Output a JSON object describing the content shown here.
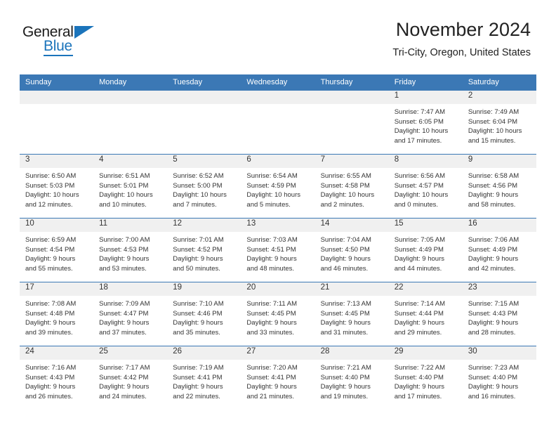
{
  "brand": {
    "name_part1": "General",
    "name_part2": "Blue",
    "accent_color": "#1b74bb"
  },
  "header": {
    "title": "November 2024",
    "subtitle": "Tri-City, Oregon, United States"
  },
  "calendar": {
    "header_color": "#3b78b5",
    "daynum_band_color": "#f0f0f0",
    "weekday_headers": [
      "Sunday",
      "Monday",
      "Tuesday",
      "Wednesday",
      "Thursday",
      "Friday",
      "Saturday"
    ],
    "weeks": [
      [
        {
          "day": "",
          "lines": []
        },
        {
          "day": "",
          "lines": []
        },
        {
          "day": "",
          "lines": []
        },
        {
          "day": "",
          "lines": []
        },
        {
          "day": "",
          "lines": []
        },
        {
          "day": "1",
          "lines": [
            "Sunrise: 7:47 AM",
            "Sunset: 6:05 PM",
            "Daylight: 10 hours",
            "and 17 minutes."
          ]
        },
        {
          "day": "2",
          "lines": [
            "Sunrise: 7:49 AM",
            "Sunset: 6:04 PM",
            "Daylight: 10 hours",
            "and 15 minutes."
          ]
        }
      ],
      [
        {
          "day": "3",
          "lines": [
            "Sunrise: 6:50 AM",
            "Sunset: 5:03 PM",
            "Daylight: 10 hours",
            "and 12 minutes."
          ]
        },
        {
          "day": "4",
          "lines": [
            "Sunrise: 6:51 AM",
            "Sunset: 5:01 PM",
            "Daylight: 10 hours",
            "and 10 minutes."
          ]
        },
        {
          "day": "5",
          "lines": [
            "Sunrise: 6:52 AM",
            "Sunset: 5:00 PM",
            "Daylight: 10 hours",
            "and 7 minutes."
          ]
        },
        {
          "day": "6",
          "lines": [
            "Sunrise: 6:54 AM",
            "Sunset: 4:59 PM",
            "Daylight: 10 hours",
            "and 5 minutes."
          ]
        },
        {
          "day": "7",
          "lines": [
            "Sunrise: 6:55 AM",
            "Sunset: 4:58 PM",
            "Daylight: 10 hours",
            "and 2 minutes."
          ]
        },
        {
          "day": "8",
          "lines": [
            "Sunrise: 6:56 AM",
            "Sunset: 4:57 PM",
            "Daylight: 10 hours",
            "and 0 minutes."
          ]
        },
        {
          "day": "9",
          "lines": [
            "Sunrise: 6:58 AM",
            "Sunset: 4:56 PM",
            "Daylight: 9 hours",
            "and 58 minutes."
          ]
        }
      ],
      [
        {
          "day": "10",
          "lines": [
            "Sunrise: 6:59 AM",
            "Sunset: 4:54 PM",
            "Daylight: 9 hours",
            "and 55 minutes."
          ]
        },
        {
          "day": "11",
          "lines": [
            "Sunrise: 7:00 AM",
            "Sunset: 4:53 PM",
            "Daylight: 9 hours",
            "and 53 minutes."
          ]
        },
        {
          "day": "12",
          "lines": [
            "Sunrise: 7:01 AM",
            "Sunset: 4:52 PM",
            "Daylight: 9 hours",
            "and 50 minutes."
          ]
        },
        {
          "day": "13",
          "lines": [
            "Sunrise: 7:03 AM",
            "Sunset: 4:51 PM",
            "Daylight: 9 hours",
            "and 48 minutes."
          ]
        },
        {
          "day": "14",
          "lines": [
            "Sunrise: 7:04 AM",
            "Sunset: 4:50 PM",
            "Daylight: 9 hours",
            "and 46 minutes."
          ]
        },
        {
          "day": "15",
          "lines": [
            "Sunrise: 7:05 AM",
            "Sunset: 4:49 PM",
            "Daylight: 9 hours",
            "and 44 minutes."
          ]
        },
        {
          "day": "16",
          "lines": [
            "Sunrise: 7:06 AM",
            "Sunset: 4:49 PM",
            "Daylight: 9 hours",
            "and 42 minutes."
          ]
        }
      ],
      [
        {
          "day": "17",
          "lines": [
            "Sunrise: 7:08 AM",
            "Sunset: 4:48 PM",
            "Daylight: 9 hours",
            "and 39 minutes."
          ]
        },
        {
          "day": "18",
          "lines": [
            "Sunrise: 7:09 AM",
            "Sunset: 4:47 PM",
            "Daylight: 9 hours",
            "and 37 minutes."
          ]
        },
        {
          "day": "19",
          "lines": [
            "Sunrise: 7:10 AM",
            "Sunset: 4:46 PM",
            "Daylight: 9 hours",
            "and 35 minutes."
          ]
        },
        {
          "day": "20",
          "lines": [
            "Sunrise: 7:11 AM",
            "Sunset: 4:45 PM",
            "Daylight: 9 hours",
            "and 33 minutes."
          ]
        },
        {
          "day": "21",
          "lines": [
            "Sunrise: 7:13 AM",
            "Sunset: 4:45 PM",
            "Daylight: 9 hours",
            "and 31 minutes."
          ]
        },
        {
          "day": "22",
          "lines": [
            "Sunrise: 7:14 AM",
            "Sunset: 4:44 PM",
            "Daylight: 9 hours",
            "and 29 minutes."
          ]
        },
        {
          "day": "23",
          "lines": [
            "Sunrise: 7:15 AM",
            "Sunset: 4:43 PM",
            "Daylight: 9 hours",
            "and 28 minutes."
          ]
        }
      ],
      [
        {
          "day": "24",
          "lines": [
            "Sunrise: 7:16 AM",
            "Sunset: 4:43 PM",
            "Daylight: 9 hours",
            "and 26 minutes."
          ]
        },
        {
          "day": "25",
          "lines": [
            "Sunrise: 7:17 AM",
            "Sunset: 4:42 PM",
            "Daylight: 9 hours",
            "and 24 minutes."
          ]
        },
        {
          "day": "26",
          "lines": [
            "Sunrise: 7:19 AM",
            "Sunset: 4:41 PM",
            "Daylight: 9 hours",
            "and 22 minutes."
          ]
        },
        {
          "day": "27",
          "lines": [
            "Sunrise: 7:20 AM",
            "Sunset: 4:41 PM",
            "Daylight: 9 hours",
            "and 21 minutes."
          ]
        },
        {
          "day": "28",
          "lines": [
            "Sunrise: 7:21 AM",
            "Sunset: 4:40 PM",
            "Daylight: 9 hours",
            "and 19 minutes."
          ]
        },
        {
          "day": "29",
          "lines": [
            "Sunrise: 7:22 AM",
            "Sunset: 4:40 PM",
            "Daylight: 9 hours",
            "and 17 minutes."
          ]
        },
        {
          "day": "30",
          "lines": [
            "Sunrise: 7:23 AM",
            "Sunset: 4:40 PM",
            "Daylight: 9 hours",
            "and 16 minutes."
          ]
        }
      ]
    ]
  }
}
